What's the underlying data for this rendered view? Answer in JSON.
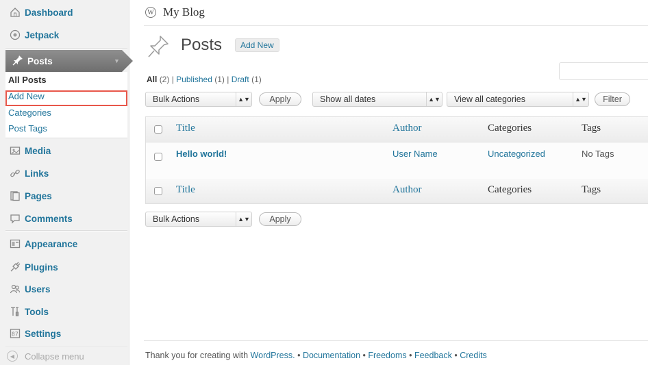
{
  "sidebar": {
    "menu": [
      {
        "label": "Dashboard",
        "icon": "dashboard-icon"
      },
      {
        "label": "Jetpack",
        "icon": "jetpack-icon"
      },
      {
        "label": "Posts",
        "icon": "pushpin-icon"
      },
      {
        "label": "Media",
        "icon": "media-icon"
      },
      {
        "label": "Links",
        "icon": "links-icon"
      },
      {
        "label": "Pages",
        "icon": "pages-icon"
      },
      {
        "label": "Comments",
        "icon": "comments-icon"
      },
      {
        "label": "Appearance",
        "icon": "appearance-icon"
      },
      {
        "label": "Plugins",
        "icon": "plugins-icon"
      },
      {
        "label": "Users",
        "icon": "users-icon"
      },
      {
        "label": "Tools",
        "icon": "tools-icon"
      },
      {
        "label": "Settings",
        "icon": "settings-icon"
      }
    ],
    "submenu": [
      "All Posts",
      "Add New",
      "Categories",
      "Post Tags"
    ],
    "collapse_label": "Collapse menu"
  },
  "header": {
    "site_title": "My Blog"
  },
  "page": {
    "title": "Posts",
    "add_new_label": "Add New"
  },
  "filters": {
    "all_label": "All",
    "all_count": "(2)",
    "sep": "|",
    "published_label": "Published",
    "published_count": "(1)",
    "draft_label": "Draft",
    "draft_count": "(1)"
  },
  "toolbar": {
    "bulk_actions": "Bulk Actions",
    "apply": "Apply",
    "dates": "Show all dates",
    "categories": "View all categories",
    "filter": "Filter"
  },
  "table": {
    "columns": [
      "Title",
      "Author",
      "Categories",
      "Tags"
    ],
    "rows": [
      {
        "title": "Hello world!",
        "author": "User Name",
        "categories": "Uncategorized",
        "tags": "No Tags"
      }
    ]
  },
  "footer": {
    "thanks": "Thank you for creating with ",
    "wordpress": "WordPress.",
    "dot": " • ",
    "documentation": "Documentation",
    "freedoms": "Freedoms",
    "feedback": "Feedback",
    "credits": "Credits"
  },
  "colors": {
    "link": "#21759b",
    "highlight_border": "#e8574a",
    "sidebar_bg": "#f1f1f1"
  }
}
